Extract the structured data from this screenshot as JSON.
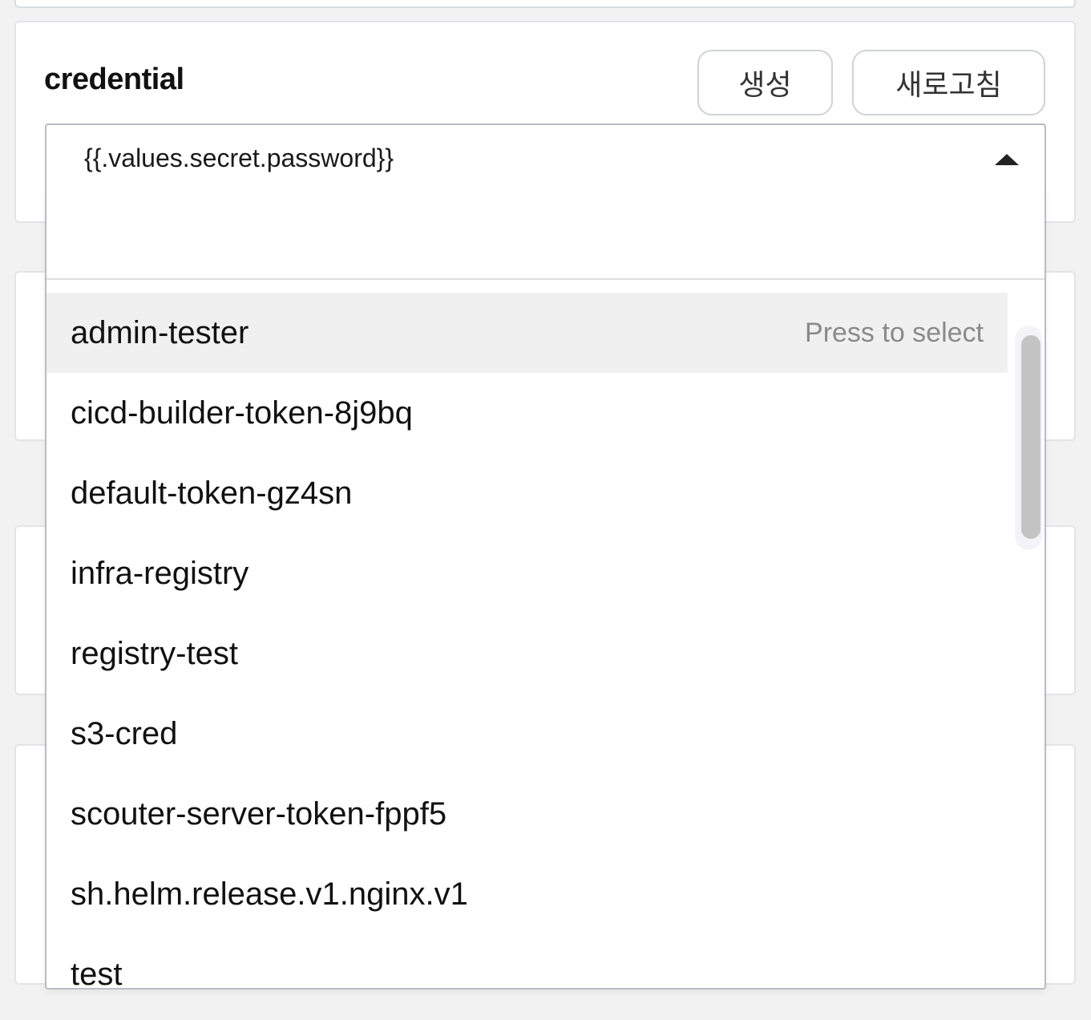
{
  "field": {
    "label": "credential",
    "create_button": "생성",
    "refresh_button": "새로고침"
  },
  "select": {
    "value": "{{.values.secret.password}}",
    "search_value": ""
  },
  "dropdown": {
    "options": [
      {
        "label": "admin-tester",
        "hint": "Press to select"
      },
      {
        "label": "cicd-builder-token-8j9bq"
      },
      {
        "label": "default-token-gz4sn"
      },
      {
        "label": "infra-registry"
      },
      {
        "label": "registry-test"
      },
      {
        "label": "s3-cred"
      },
      {
        "label": "scouter-server-token-fppf5"
      },
      {
        "label": "sh.helm.release.v1.nginx.v1"
      },
      {
        "label": "test"
      }
    ]
  },
  "colors": {
    "highlight": "#f0f0f0",
    "hint_text": "#8a8a8a",
    "scrollbar_thumb": "#c4c4c4"
  }
}
